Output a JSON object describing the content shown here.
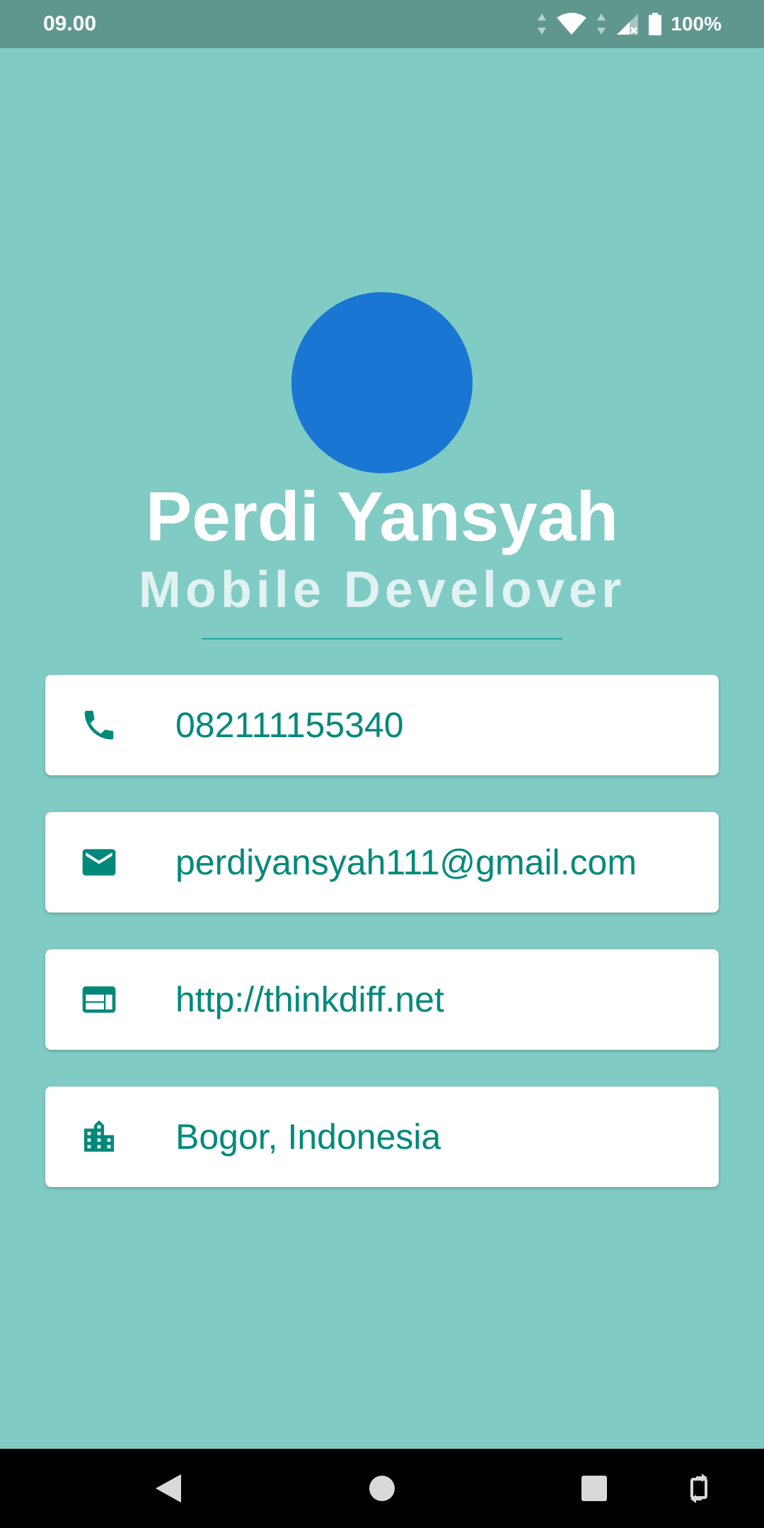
{
  "status_bar": {
    "time": "09.00",
    "battery_percent": "100%",
    "icons": [
      "data-arrows-icon",
      "wifi-icon",
      "signal-icon",
      "battery-icon"
    ]
  },
  "profile": {
    "name": "Perdi Yansyah",
    "title": "Mobile Develover",
    "avatar_color": "#1976D2"
  },
  "contacts": [
    {
      "icon": "phone-icon",
      "text": "082111155340"
    },
    {
      "icon": "mail-icon",
      "text": "perdiyansyah111@gmail.com"
    },
    {
      "icon": "web-icon",
      "text": "http://thinkdiff.net"
    },
    {
      "icon": "city-icon",
      "text": "Bogor, Indonesia"
    }
  ],
  "nav_bar": {
    "buttons": [
      "back-icon",
      "home-icon",
      "recents-icon",
      "rotate-icon"
    ]
  },
  "colors": {
    "background": "#80CBC4",
    "status_bar": "#5F978F",
    "accent": "#00897B",
    "name_text": "#FFFFFF",
    "title_text": "#E0F2F1",
    "card": "#FFFFFF"
  }
}
